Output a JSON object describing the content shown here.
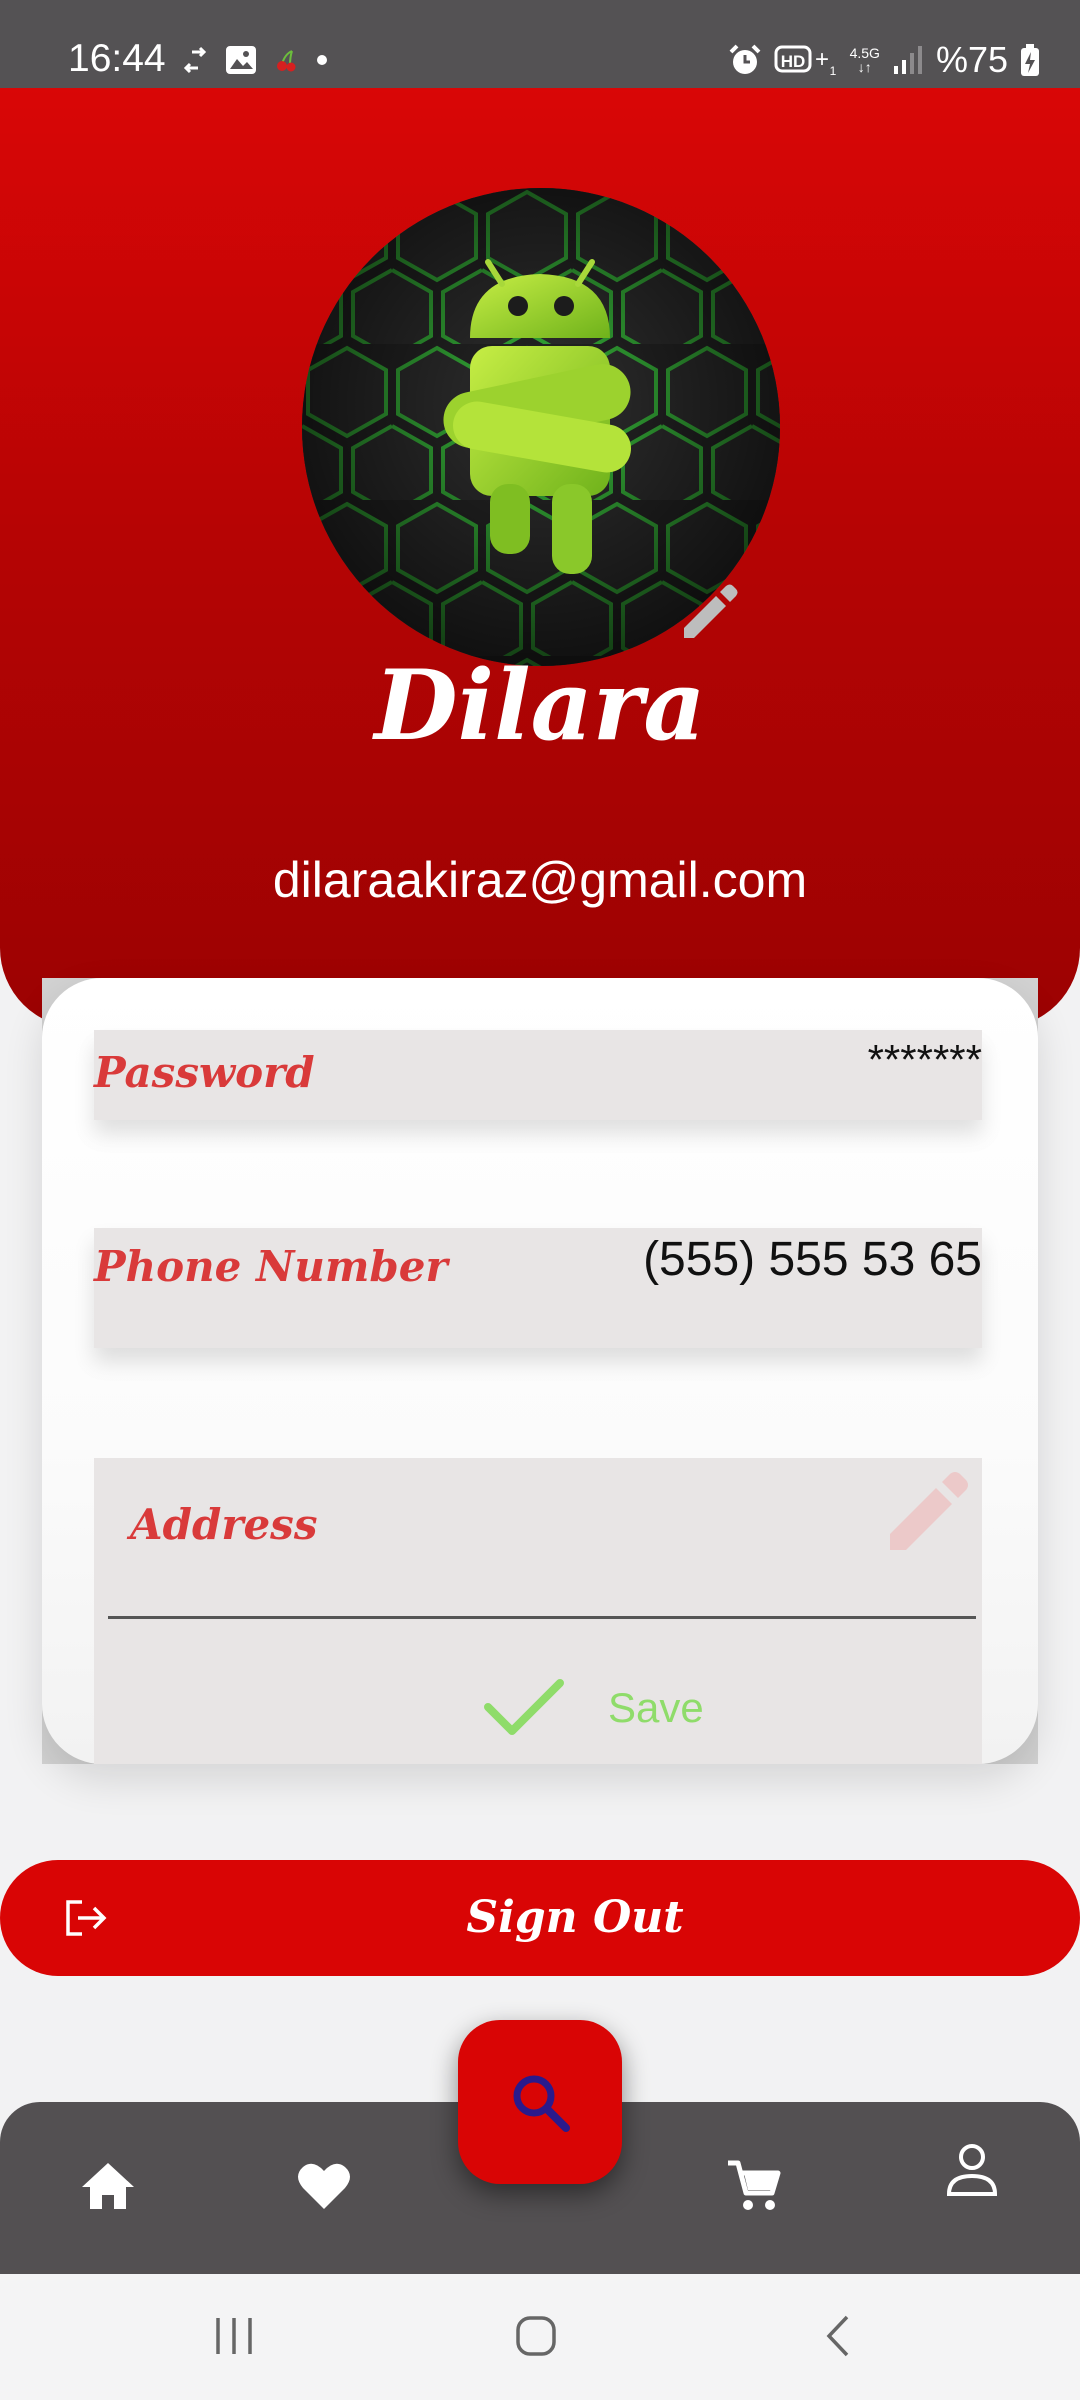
{
  "status_bar": {
    "time": "16:44",
    "left_icons": [
      "sync-icon",
      "gallery-icon",
      "cherry-icon",
      "dot-icon"
    ],
    "right_icons": [
      "alarm-icon",
      "hd-plus-icon",
      "network-4-5g-icon",
      "signal-icon"
    ],
    "network_label": "4.5G",
    "battery_text": "%75"
  },
  "profile": {
    "name": "Dilara",
    "email": "dilaraakiraz@gmail.com",
    "avatar_icon": "android-robot-avatar",
    "edit_icon": "pencil-icon"
  },
  "fields": {
    "password": {
      "label": "Password",
      "value": "*******"
    },
    "phone": {
      "label": "Phone Number",
      "value": "(555) 555 53 65"
    },
    "address": {
      "label": "Address",
      "value": "",
      "edit_icon": "pencil-icon"
    }
  },
  "save": {
    "label": "Save",
    "icon": "check-icon"
  },
  "sign_out": {
    "label": "Sign Out",
    "icon": "logout-icon"
  },
  "bottom_nav": {
    "items": [
      {
        "name": "home",
        "icon": "home-icon"
      },
      {
        "name": "favorites",
        "icon": "heart-icon"
      },
      {
        "name": "cart",
        "icon": "cart-icon"
      },
      {
        "name": "profile",
        "icon": "user-icon"
      }
    ],
    "fab_icon": "search-icon"
  },
  "colors": {
    "primary": "#d90505",
    "header_dark": "#9c0202",
    "nav_background": "#535052",
    "field_label": "#d93a3a",
    "field_background": "#e8e5e5",
    "save_green": "#8fdc6a",
    "search_icon": "#2a1a8c"
  }
}
